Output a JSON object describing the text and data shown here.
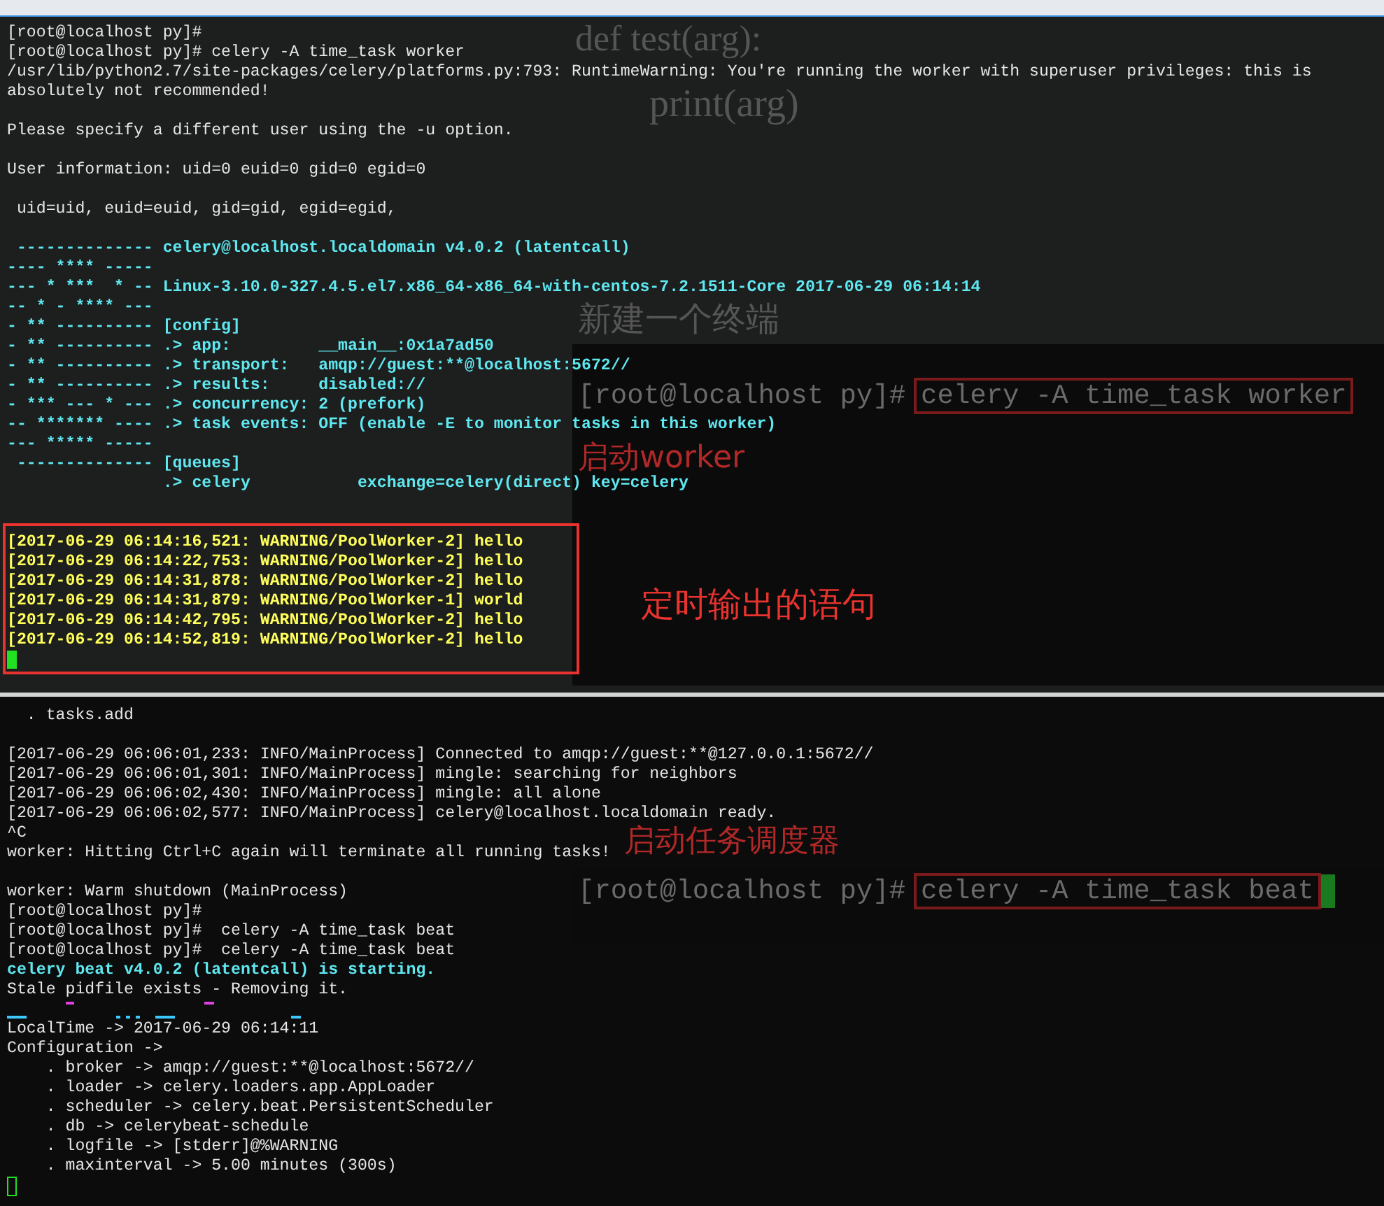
{
  "document": {
    "signature": "def test(arg):",
    "body": "print(arg)",
    "heading": "新建一个终端",
    "worker_step": {
      "prompt": "[root@localhost py]#",
      "command": "celery -A time_task worker",
      "caption": "启动worker"
    },
    "beat_step": {
      "caption": "启动任务调度器",
      "prompt": "[root@localhost py]#",
      "command": "celery -A time_task beat"
    }
  },
  "top_terminal": {
    "lines": [
      {
        "kind": "plain",
        "text": "[root@localhost py]#"
      },
      {
        "kind": "plain",
        "text": "[root@localhost py]# celery -A time_task worker"
      },
      {
        "kind": "plain",
        "text": "/usr/lib/python2.7/site-packages/celery/platforms.py:793: RuntimeWarning: You're running the worker with superuser privileges: this is"
      },
      {
        "kind": "plain",
        "text": "absolutely not recommended!"
      },
      {
        "kind": "blank"
      },
      {
        "kind": "plain",
        "text": "Please specify a different user using the -u option."
      },
      {
        "kind": "blank"
      },
      {
        "kind": "plain",
        "text": "User information: uid=0 euid=0 gid=0 egid=0"
      },
      {
        "kind": "blank"
      },
      {
        "kind": "plain",
        "text": " uid=uid, euid=euid, gid=gid, egid=egid,"
      },
      {
        "kind": "blank"
      },
      {
        "kind": "banner",
        "text": " -------------- celery@localhost.localdomain v4.0.2 (latentcall)"
      },
      {
        "kind": "banner",
        "text": "---- **** -----"
      },
      {
        "kind": "banner",
        "text": "--- * ***  * -- Linux-3.10.0-327.4.5.el7.x86_64-x86_64-with-centos-7.2.1511-Core 2017-06-29 06:14:14"
      },
      {
        "kind": "banner",
        "text": "-- * - **** ---"
      },
      {
        "kind": "banner",
        "text": "- ** ---------- [config]"
      },
      {
        "kind": "banner",
        "text": "- ** ---------- .> app:         __main__:0x1a7ad50"
      },
      {
        "kind": "banner",
        "text": "- ** ---------- .> transport:   amqp://guest:**@localhost:5672//"
      },
      {
        "kind": "banner",
        "text": "- ** ---------- .> results:     disabled://"
      },
      {
        "kind": "banner",
        "text": "- *** --- * --- .> concurrency: 2 (prefork)"
      },
      {
        "kind": "banner",
        "text": "-- ******* ---- .> task events: OFF (enable -E to monitor tasks in this worker)"
      },
      {
        "kind": "banner",
        "text": "--- ***** -----"
      },
      {
        "kind": "banner",
        "text": " -------------- [queues]"
      },
      {
        "kind": "banner",
        "text": "                .> celery           exchange=celery(direct) key=celery"
      },
      {
        "kind": "blank"
      },
      {
        "kind": "blank"
      }
    ],
    "highlighted_lines": [
      "[2017-06-29 06:14:16,521: WARNING/PoolWorker-2] hello",
      "[2017-06-29 06:14:22,753: WARNING/PoolWorker-2] hello",
      "[2017-06-29 06:14:31,878: WARNING/PoolWorker-2] hello",
      "[2017-06-29 06:14:31,879: WARNING/PoolWorker-1] world",
      "[2017-06-29 06:14:42,795: WARNING/PoolWorker-2] hello",
      "[2017-06-29 06:14:52,819: WARNING/PoolWorker-2] hello"
    ],
    "cursor": {
      "kind": "block"
    },
    "annotation": "定时输出的语句"
  },
  "bottom_terminal": {
    "lines": [
      {
        "kind": "plain",
        "text": "  . tasks.add"
      },
      {
        "kind": "blank"
      },
      {
        "kind": "plain",
        "text": "[2017-06-29 06:06:01,233: INFO/MainProcess] Connected to amqp://guest:**@127.0.0.1:5672//"
      },
      {
        "kind": "plain",
        "text": "[2017-06-29 06:06:01,301: INFO/MainProcess] mingle: searching for neighbors"
      },
      {
        "kind": "plain",
        "text": "[2017-06-29 06:06:02,430: INFO/MainProcess] mingle: all alone"
      },
      {
        "kind": "plain",
        "text": "[2017-06-29 06:06:02,577: INFO/MainProcess] celery@localhost.localdomain ready."
      },
      {
        "kind": "plain",
        "text": "^C"
      },
      {
        "kind": "plain",
        "text": "worker: Hitting Ctrl+C again will terminate all running tasks!"
      },
      {
        "kind": "blank"
      },
      {
        "kind": "plain",
        "text": "worker: Warm shutdown (MainProcess)"
      },
      {
        "kind": "plain",
        "text": "[root@localhost py]#"
      },
      {
        "kind": "plain",
        "text": "[root@localhost py]#  celery -A time_task beat"
      },
      {
        "kind": "plain",
        "text": "[root@localhost py]#  celery -A time_task beat"
      },
      {
        "kind": "title",
        "text": "celery beat v4.0.2 (latentcall) is starting."
      },
      {
        "kind": "plain",
        "text": "Stale pidfile exists - Removing it."
      },
      {
        "kind": "fragment"
      },
      {
        "kind": "plain",
        "text": "LocalTime -> 2017-06-29 06:14:11"
      },
      {
        "kind": "plain",
        "text": "Configuration ->"
      },
      {
        "kind": "plain",
        "text": "    . broker -> amqp://guest:**@localhost:5672//"
      },
      {
        "kind": "plain",
        "text": "    . loader -> celery.loaders.app.AppLoader"
      },
      {
        "kind": "plain",
        "text": "    . scheduler -> celery.beat.PersistentScheduler"
      },
      {
        "kind": "plain",
        "text": "    . db -> celerybeat-schedule"
      },
      {
        "kind": "plain",
        "text": "    . logfile -> [stderr]@%WARNING"
      },
      {
        "kind": "plain",
        "text": "    . maxinterval -> 5.00 minutes (300s)"
      }
    ],
    "cursor": {
      "kind": "hollow"
    }
  }
}
